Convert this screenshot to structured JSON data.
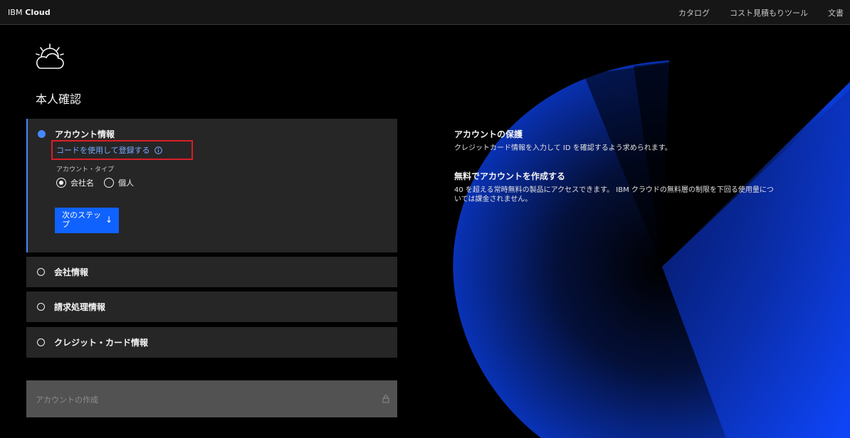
{
  "header": {
    "brand_prefix": "IBM",
    "brand_name": "Cloud",
    "nav": [
      "カタログ",
      "コスト見積もりツール",
      "文書"
    ]
  },
  "page": {
    "title": "本人確認"
  },
  "account_info": {
    "title": "アカウント情報",
    "code_link": "コードを使用して登録する",
    "account_type_label": "アカウント・タイプ",
    "options": [
      "会社名",
      "個人"
    ],
    "selected_option": "会社名",
    "next_button": "次のステップ"
  },
  "sections": [
    "会社情報",
    "請求処理情報",
    "クレジット・カード情報"
  ],
  "create_button": "アカウントの作成",
  "info": {
    "protect_title": "アカウントの保護",
    "protect_text": "クレジットカード情報を入力して ID を確認するよう求められます。",
    "free_title": "無料でアカウントを作成する",
    "free_text": "40 を超える常時無料の製品にアクセスできます。 IBM クラウドの無料層の制限を下回る使用量については課金されません。"
  },
  "colors": {
    "accent": "#0f62fe",
    "link": "#78a9ff",
    "highlight": "#da1e28",
    "active_dot": "#4589ff"
  },
  "icons": [
    "cloud-sun-logo-icon",
    "info-icon",
    "arrow-down-icon",
    "lock-icon"
  ]
}
